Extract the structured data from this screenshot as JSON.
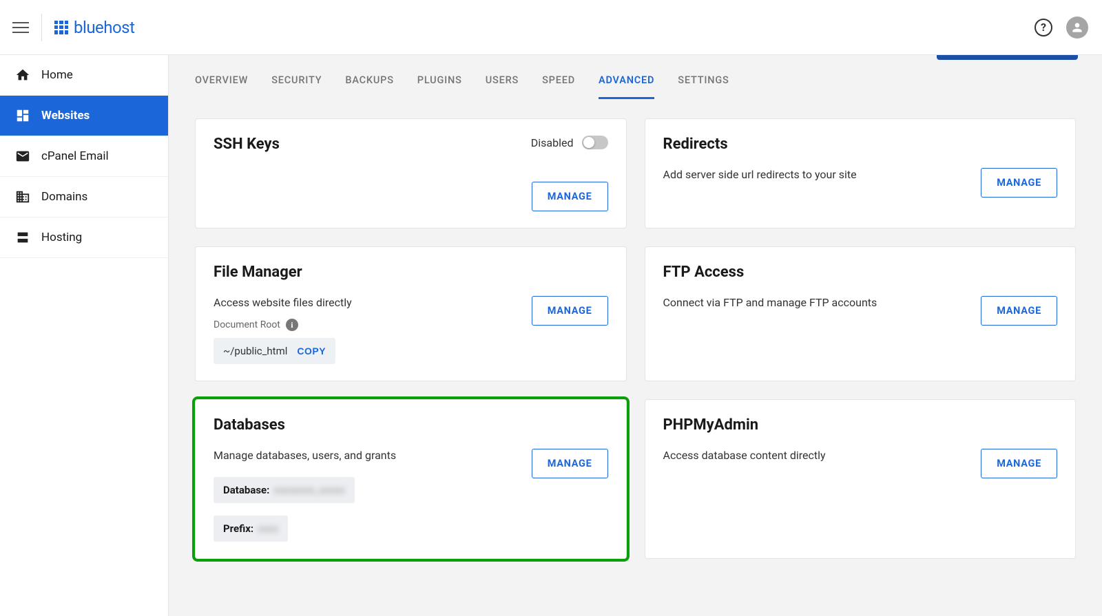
{
  "brand": "bluehost",
  "sidebar": {
    "items": [
      {
        "label": "Home"
      },
      {
        "label": "Websites"
      },
      {
        "label": "cPanel Email"
      },
      {
        "label": "Domains"
      },
      {
        "label": "Hosting"
      }
    ]
  },
  "tabs": [
    "OVERVIEW",
    "SECURITY",
    "BACKUPS",
    "PLUGINS",
    "USERS",
    "SPEED",
    "ADVANCED",
    "SETTINGS"
  ],
  "buttons": {
    "manage": "MANAGE",
    "copy": "COPY"
  },
  "cards": {
    "ssh": {
      "title": "SSH Keys",
      "toggle_label": "Disabled"
    },
    "redirects": {
      "title": "Redirects",
      "desc": "Add server side url redirects to your site"
    },
    "filemgr": {
      "title": "File Manager",
      "desc": "Access website files directly",
      "doc_root_label": "Document Root",
      "doc_root_path": "~/public_html"
    },
    "ftp": {
      "title": "FTP Access",
      "desc": "Connect via FTP and manage FTP accounts"
    },
    "db": {
      "title": "Databases",
      "desc": "Manage databases, users, and grants",
      "db_label": "Database:",
      "db_value": "xxxxxxxx_xxxxx",
      "prefix_label": "Prefix:",
      "prefix_value": "xxxx"
    },
    "pma": {
      "title": "PHPMyAdmin",
      "desc": "Access database content directly"
    }
  }
}
